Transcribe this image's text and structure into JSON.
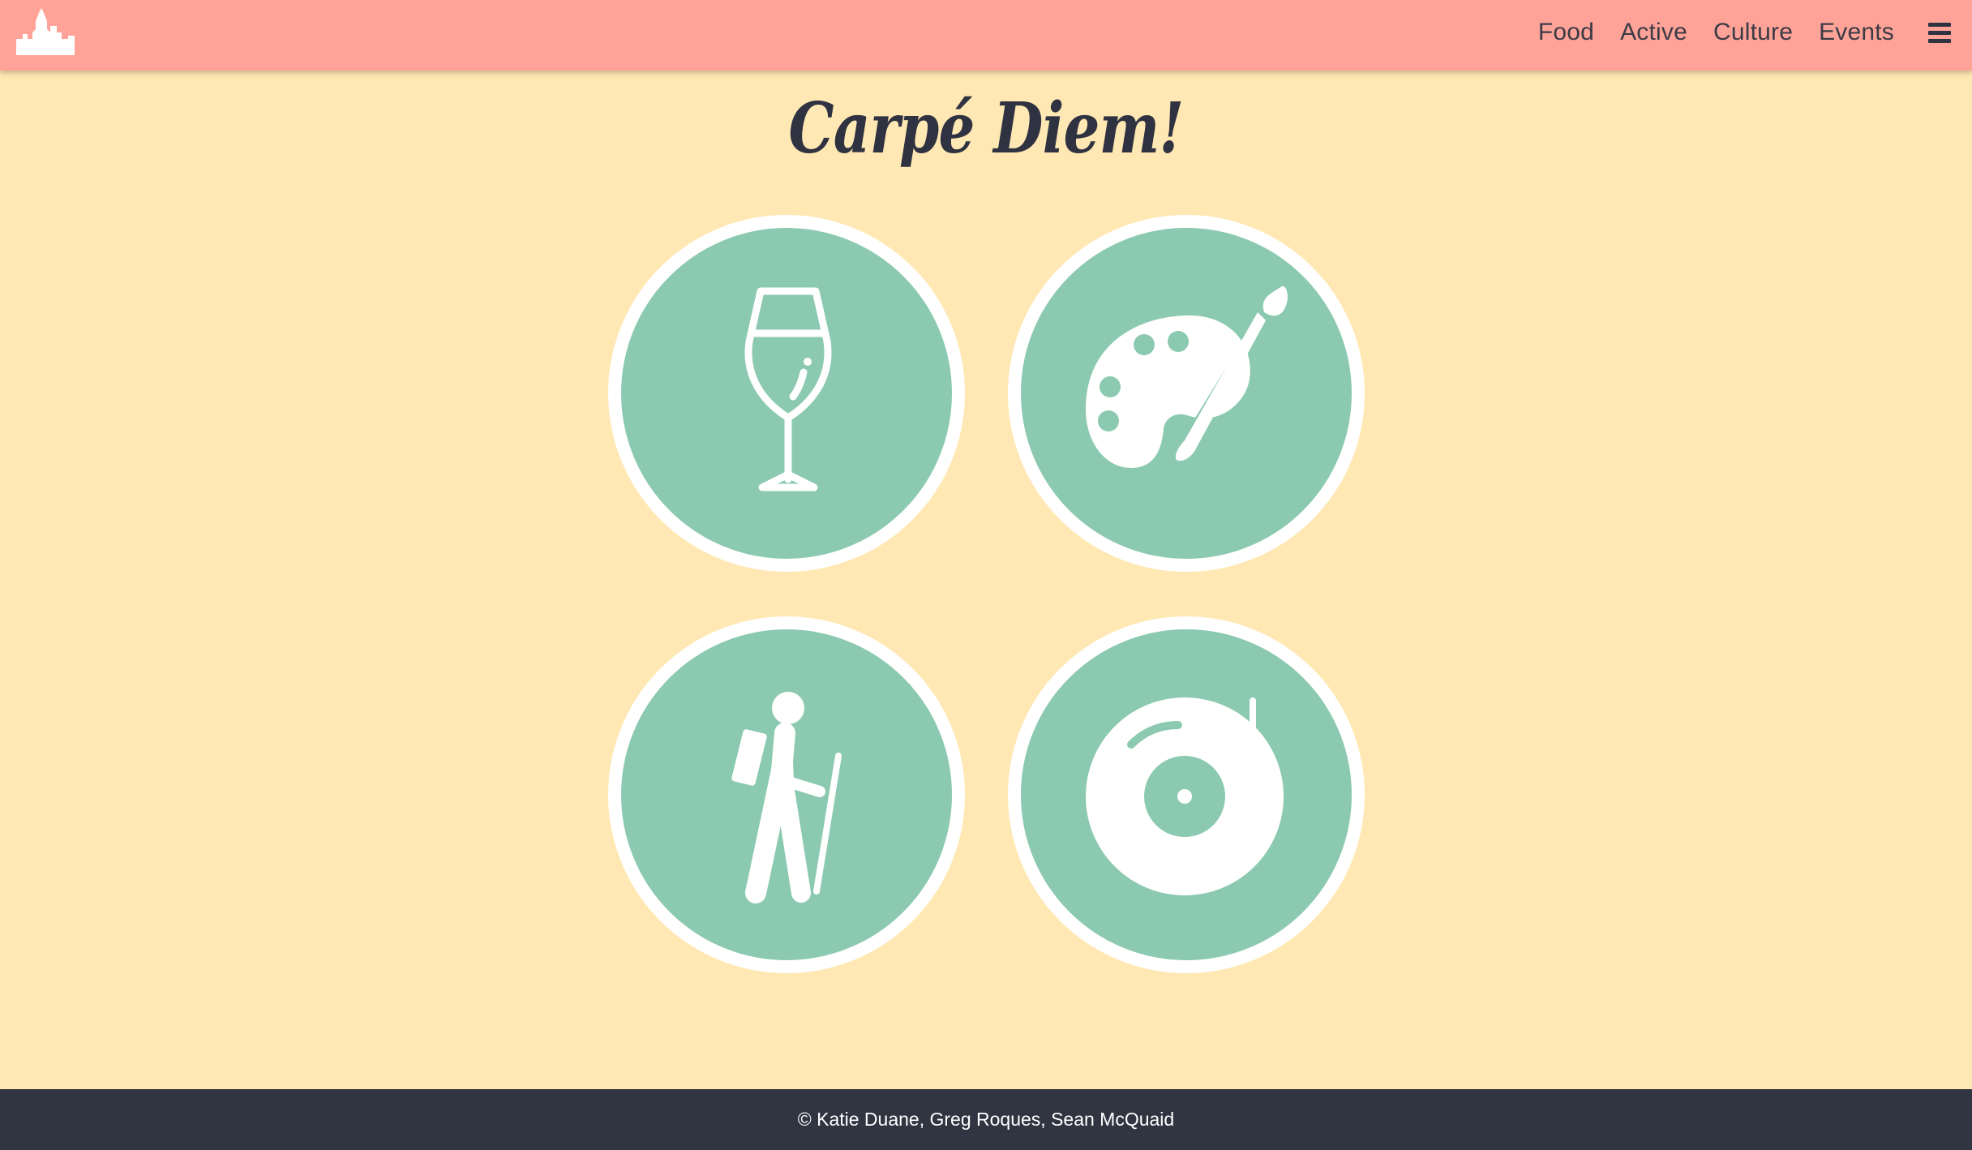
{
  "nav": {
    "links": [
      "Food",
      "Active",
      "Culture",
      "Events"
    ],
    "logo_icon": "city-skyline-icon",
    "menu_icon": "hamburger-menu-icon"
  },
  "hero": {
    "title": "Carpé Diem!"
  },
  "categories": [
    {
      "icon": "wine-glass-icon"
    },
    {
      "icon": "palette-brush-icon"
    },
    {
      "icon": "hiker-icon"
    },
    {
      "icon": "record-player-icon"
    }
  ],
  "footer": {
    "copyright": "© Katie Duane, Greg Roques, Sean McQuaid"
  },
  "colors": {
    "background": "#ffe8b3",
    "navbar": "#ffa398",
    "circle": "#8cc9b1",
    "circle_border": "#ffffff",
    "text_dark": "#2f3240",
    "footer": "#313542"
  }
}
